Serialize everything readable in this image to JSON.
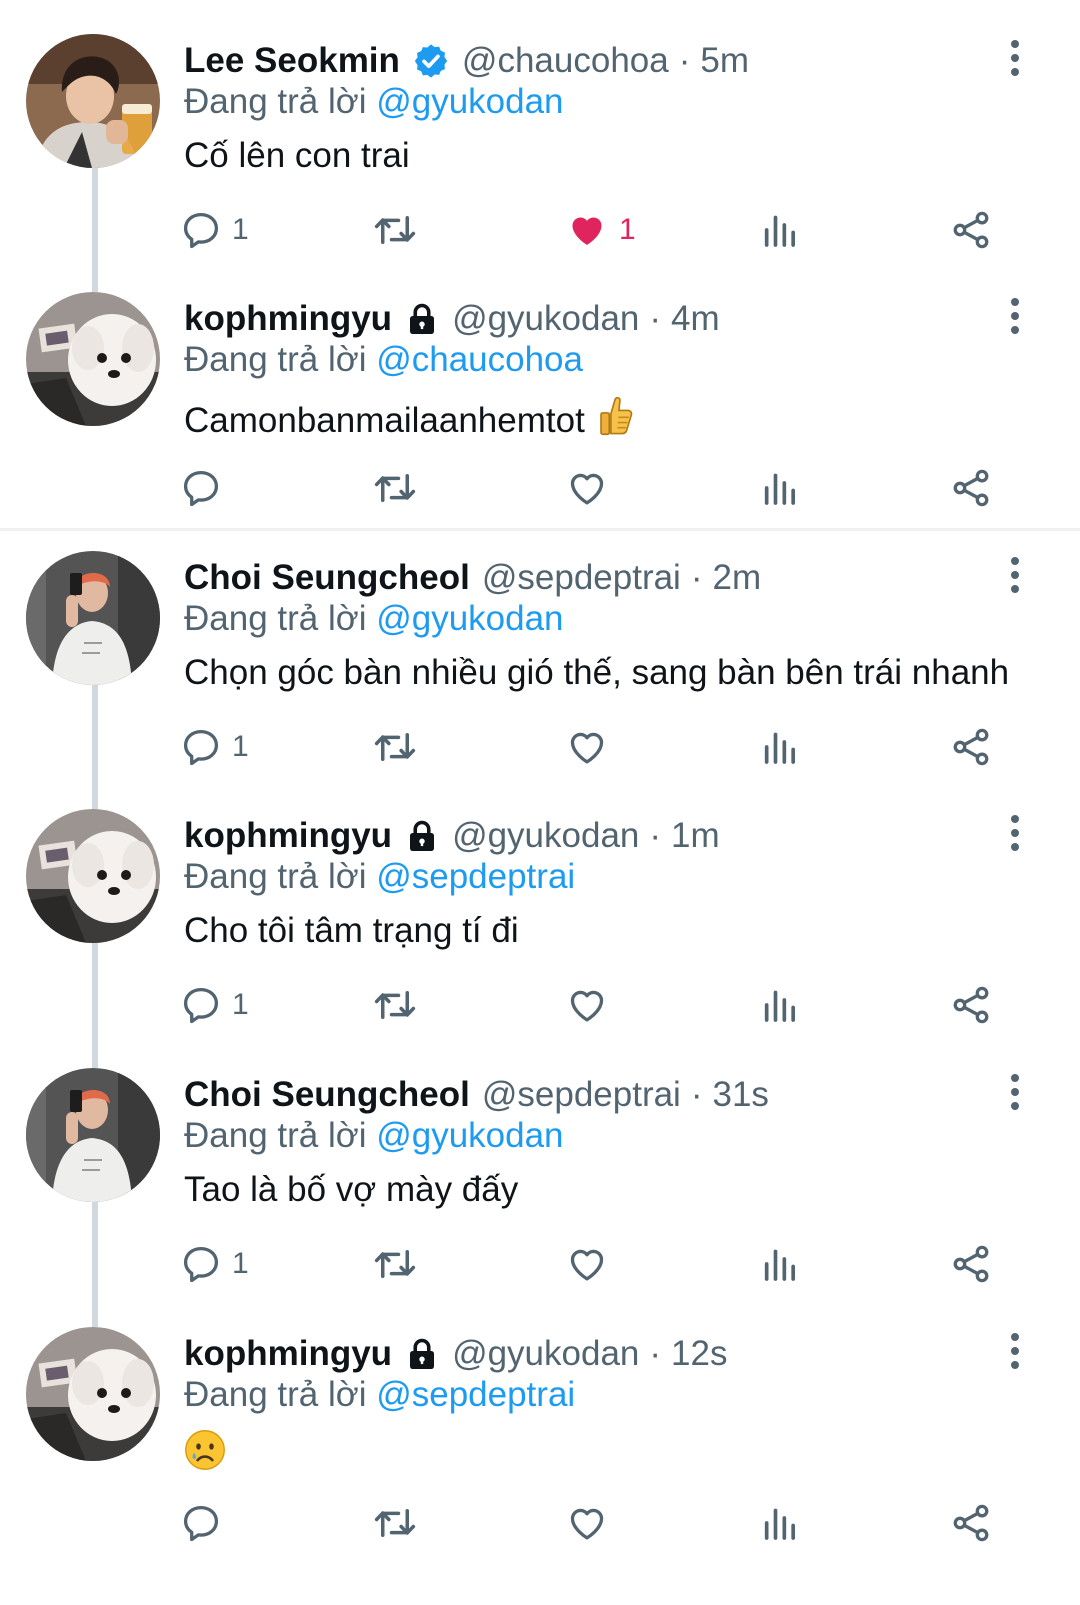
{
  "replies": [
    {
      "name": "Lee Seokmin",
      "badge": "verified",
      "handle": "@chaucohoa",
      "sep": "·",
      "time": "5m",
      "replying_prefix": "Đang trả lời ",
      "replying_to": "@gyukodan",
      "text": "Cố lên con trai",
      "emoji": "",
      "avatar": "portrait-with-drink",
      "reply_count": "1",
      "retweet_count": "",
      "like_count": "1",
      "liked": true
    },
    {
      "name": "kophmingyu",
      "badge": "lock",
      "handle": "@gyukodan",
      "sep": "·",
      "time": "4m",
      "replying_prefix": "Đang trả lời ",
      "replying_to": "@chaucohoa",
      "text": "Camonbanmailaanhemtot",
      "emoji": "thumbs-up",
      "avatar": "white-dog",
      "reply_count": "",
      "retweet_count": "",
      "like_count": "",
      "liked": false
    },
    {
      "name": "Choi Seungcheol",
      "badge": "",
      "handle": "@sepdeptrai",
      "sep": "·",
      "time": "2m",
      "replying_prefix": "Đang trả lời ",
      "replying_to": "@gyukodan",
      "text": "Chọn góc bàn nhiều gió thế, sang bàn bên trái nhanh",
      "emoji": "",
      "avatar": "mirror-selfie",
      "reply_count": "1",
      "retweet_count": "",
      "like_count": "",
      "liked": false
    },
    {
      "name": "kophmingyu",
      "badge": "lock",
      "handle": "@gyukodan",
      "sep": "·",
      "time": "1m",
      "replying_prefix": "Đang trả lời ",
      "replying_to": "@sepdeptrai",
      "text": "Cho tôi tâm trạng tí đi",
      "emoji": "",
      "avatar": "white-dog",
      "reply_count": "1",
      "retweet_count": "",
      "like_count": "",
      "liked": false
    },
    {
      "name": "Choi Seungcheol",
      "badge": "",
      "handle": "@sepdeptrai",
      "sep": "·",
      "time": "31s",
      "replying_prefix": "Đang trả lời ",
      "replying_to": "@gyukodan",
      "text": "Tao là bố vợ mày đấy",
      "emoji": "",
      "avatar": "mirror-selfie",
      "reply_count": "1",
      "retweet_count": "",
      "like_count": "",
      "liked": false
    },
    {
      "name": "kophmingyu",
      "badge": "lock",
      "handle": "@gyukodan",
      "sep": "·",
      "time": "12s",
      "replying_prefix": "Đang trả lời ",
      "replying_to": "@sepdeptrai",
      "text": "",
      "emoji": "sad-face",
      "avatar": "white-dog",
      "reply_count": "",
      "retweet_count": "",
      "like_count": "",
      "liked": false
    }
  ],
  "colors": {
    "text": "#0f1419",
    "secondary": "#536471",
    "link": "#1d9bf0",
    "like_active": "#e0245e",
    "verified": "#1d9bf0",
    "thread_line": "#cfd9de"
  }
}
